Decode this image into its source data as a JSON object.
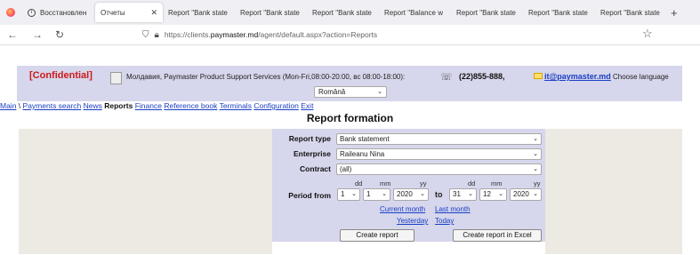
{
  "browser": {
    "tabs": [
      {
        "label": "Восстановлен",
        "active": false
      },
      {
        "label": "Отчеты",
        "active": true
      },
      {
        "label": "Report \"Bank state",
        "active": false
      },
      {
        "label": "Report \"Bank state",
        "active": false
      },
      {
        "label": "Report \"Bank state",
        "active": false
      },
      {
        "label": "Report \"Balance w",
        "active": false
      },
      {
        "label": "Report \"Bank state",
        "active": false
      },
      {
        "label": "Report \"Bank state",
        "active": false
      },
      {
        "label": "Report \"Bank state",
        "active": false
      }
    ],
    "url_prefix": "https://clients.",
    "url_host": "paymaster.md",
    "url_path": "/agent/default.aspx?action=Reports"
  },
  "header": {
    "confidential": "[Confidential]",
    "company": "Молдавия, Paymaster Product Support Services (Mon-Fri,08:00-20:00, вс 08:00-18:00):",
    "phone": "(22)855-888,",
    "email": "it@paymaster.md",
    "choose_language": "Choose language",
    "language_value": "Română"
  },
  "menu": {
    "main": "Main",
    "sep": " \\ ",
    "payments_search": "Payments search",
    "news": "News",
    "reports": "Reports",
    "finance": "Finance",
    "reference_book": "Reference book",
    "terminals": "Terminals",
    "configuration": "Configuration",
    "exit": "Exit"
  },
  "form": {
    "title": "Report formation",
    "report_type_label": "Report type",
    "report_type_value": "Bank statement",
    "enterprise_label": "Enterprise",
    "enterprise_value": "Raileanu Nina",
    "contract_label": "Contract",
    "contract_value": "(all)",
    "period_label": "Period from",
    "dd": "dd",
    "mm": "mm",
    "yy": "yy",
    "to": "to",
    "from_day": "1",
    "from_month": "1",
    "from_year": "2020",
    "to_day": "31",
    "to_month": "12",
    "to_year": "2020",
    "current_month": "Current month",
    "last_month": "Last month",
    "yesterday": "Yesterday",
    "today": "Today",
    "create_report": "Create report",
    "create_report_excel": "Create report in Excel"
  },
  "colors": {
    "panel": "#d6d6ec",
    "side": "#eceae3",
    "link": "#1a3fc4",
    "confidential": "#cc1a1a"
  }
}
